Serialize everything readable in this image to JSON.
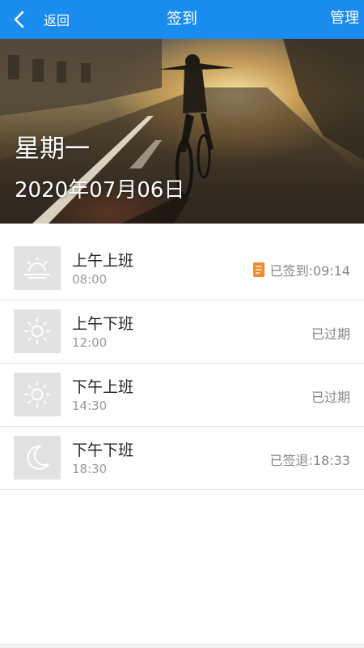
{
  "header": {
    "back_label": "返回",
    "title": "签到",
    "manage_label": "管理",
    "bar_color": "#1a8cf0"
  },
  "hero": {
    "weekday": "星期一",
    "date": "2020年07月06日"
  },
  "records": [
    {
      "icon": "sunrise-icon",
      "label": "上午上班",
      "time": "08:00",
      "status": "已签到:09:14",
      "status_icon": "document-icon"
    },
    {
      "icon": "sun-icon",
      "label": "上午下班",
      "time": "12:00",
      "status": "已过期"
    },
    {
      "icon": "sun-icon",
      "label": "下午上班",
      "time": "14:30",
      "status": "已过期"
    },
    {
      "icon": "moon-icon",
      "label": "下午下班",
      "time": "18:30",
      "status": "已签退:18:33"
    }
  ]
}
